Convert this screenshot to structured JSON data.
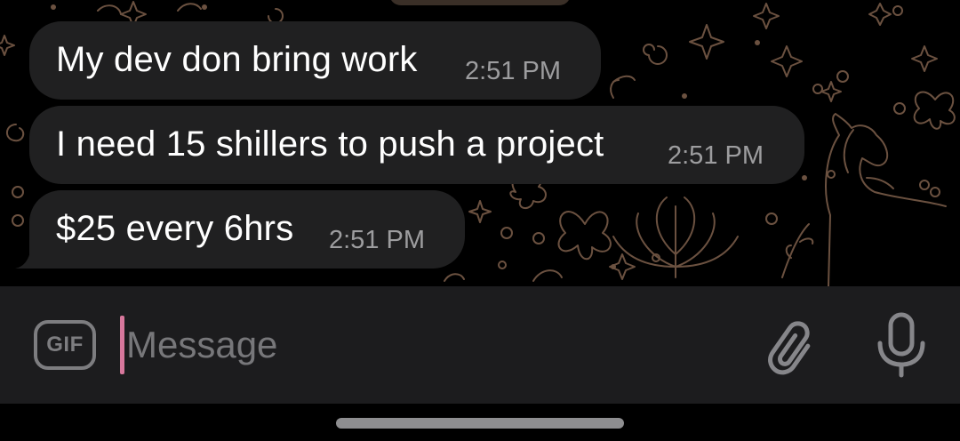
{
  "chat": {
    "messages": [
      {
        "text": "My dev don bring work",
        "time": "2:51 PM"
      },
      {
        "text": "I need 15 shillers to push a project",
        "time": "2:51 PM"
      },
      {
        "text": "$25 every 6hrs",
        "time": "2:51 PM"
      }
    ]
  },
  "input_bar": {
    "gif_label": "GIF",
    "placeholder": "Message",
    "value": "",
    "attach_icon": "paperclip-icon",
    "mic_icon": "microphone-icon",
    "caret_color": "#d7779c"
  },
  "colors": {
    "background": "#000000",
    "bubble": "#202021",
    "input_bar": "#1c1c1e",
    "timestamp": "#9d9d9f",
    "doodle": "#6b5140"
  }
}
